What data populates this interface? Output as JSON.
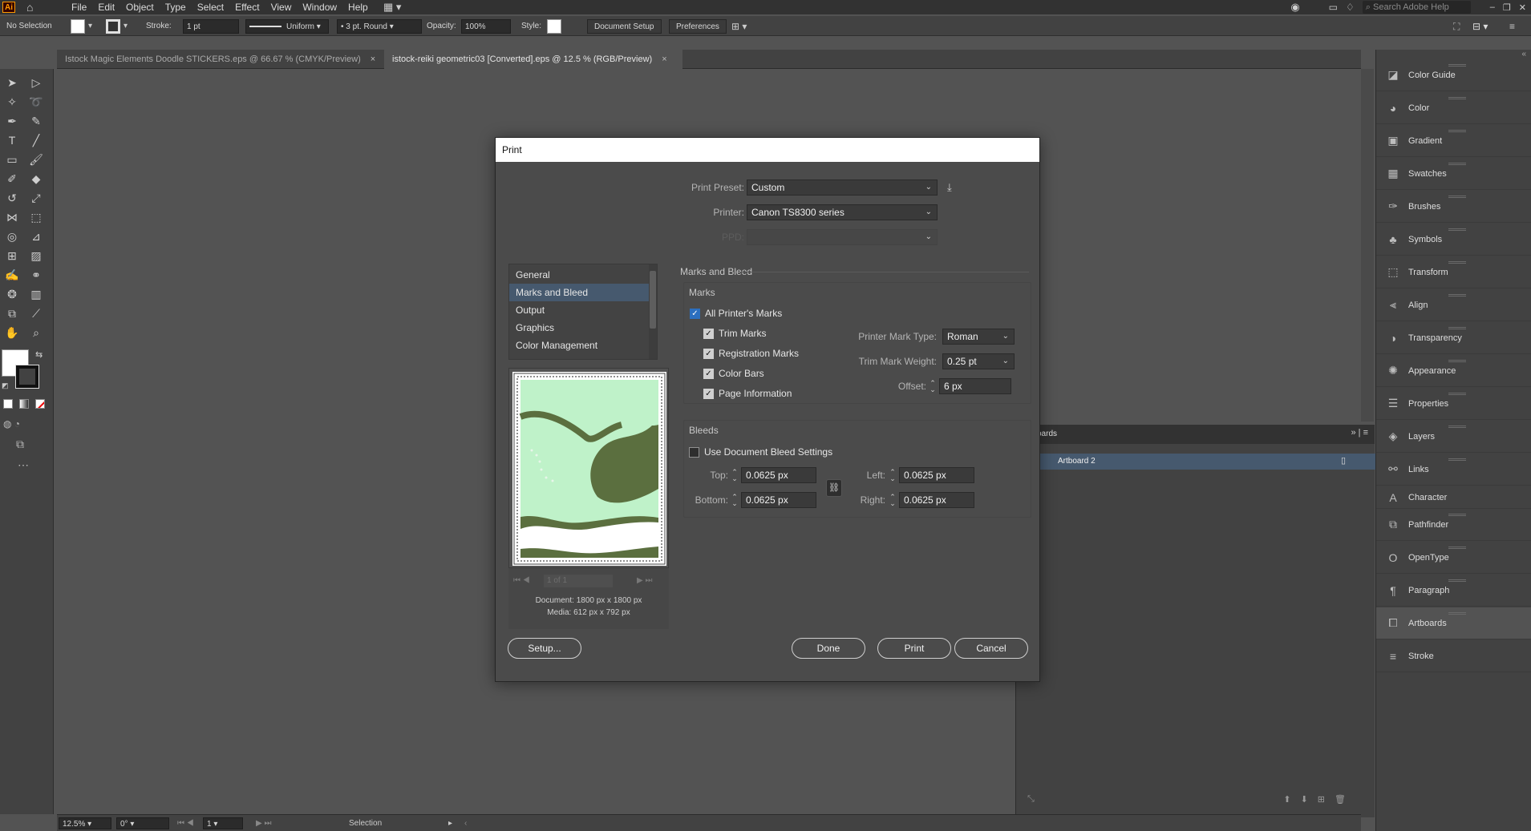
{
  "menubar": {
    "app_logo": "Ai",
    "items": [
      "File",
      "Edit",
      "Object",
      "Type",
      "Select",
      "Effect",
      "View",
      "Window",
      "Help"
    ],
    "search_placeholder": "Search Adobe Help"
  },
  "controlbar": {
    "selection": "No Selection",
    "stroke_label": "Stroke:",
    "stroke_value": "1 pt",
    "profile": "Uniform",
    "brush": "3 pt. Round",
    "opacity_label": "Opacity:",
    "opacity_value": "100%",
    "style_label": "Style:",
    "document_setup": "Document Setup",
    "preferences": "Preferences"
  },
  "tabs": [
    {
      "label": "Istock Magic Elements Doodle STICKERS.eps @ 66.67 % (CMYK/Preview)",
      "close": "×"
    },
    {
      "label": "istock-reiki geometric03 [Converted].eps @ 12.5 % (RGB/Preview)",
      "close": "×"
    }
  ],
  "right_dock": {
    "items": [
      "Color Guide",
      "Color",
      "Gradient",
      "Swatches",
      "Brushes",
      "Symbols",
      "Transform",
      "Align",
      "Transparency",
      "Appearance",
      "Properties",
      "Layers",
      "Links",
      "Character",
      "Pathfinder",
      "OpenType",
      "Paragraph",
      "Artboards",
      "Stroke"
    ],
    "active": "Artboards"
  },
  "artboards_panel": {
    "title": "oards",
    "rows": [
      "Artboard 2"
    ]
  },
  "status": {
    "zoom": "12.5%",
    "rotation": "0°",
    "artboard": "1",
    "tool": "Selection"
  },
  "dialog": {
    "title": "Print",
    "print_preset_label": "Print Preset:",
    "print_preset_value": "Custom",
    "printer_label": "Printer:",
    "printer_value": "Canon TS8300 series",
    "ppd_label": "PPD:",
    "categories": [
      "General",
      "Marks and Bleed",
      "Output",
      "Graphics",
      "Color Management"
    ],
    "selected_category": "Marks and Bleed",
    "section_title": "Marks and Bleed",
    "marks": {
      "title": "Marks",
      "all_printers_marks": "All Printer's Marks",
      "trim_marks": "Trim Marks",
      "registration_marks": "Registration Marks",
      "color_bars": "Color Bars",
      "page_information": "Page Information",
      "mark_type_label": "Printer Mark Type:",
      "mark_type_value": "Roman",
      "trim_weight_label": "Trim Mark Weight:",
      "trim_weight_value": "0.25 pt",
      "offset_label": "Offset:",
      "offset_value": "6 px"
    },
    "bleeds": {
      "title": "Bleeds",
      "use_doc_bleed": "Use Document Bleed Settings",
      "top_label": "Top:",
      "top_value": "0.0625 px",
      "bottom_label": "Bottom:",
      "bottom_value": "0.0625 px",
      "left_label": "Left:",
      "left_value": "0.0625 px",
      "right_label": "Right:",
      "right_value": "0.0625 px"
    },
    "preview": {
      "page": "1 of 1",
      "document": "Document: 1800 px x 1800 px",
      "media": "Media: 612 px x 792 px"
    },
    "buttons": {
      "setup": "Setup...",
      "done": "Done",
      "print": "Print",
      "cancel": "Cancel"
    }
  }
}
